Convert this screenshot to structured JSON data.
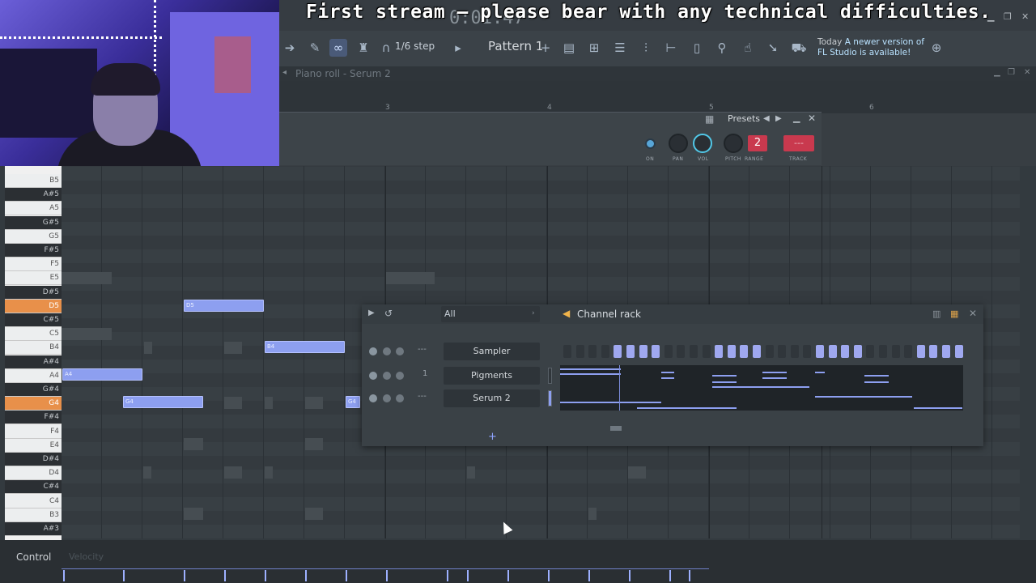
{
  "caption": "First stream – please bear with any technical difficulties.",
  "clock": "0:01:47",
  "toolbar": {
    "snap": "1/6 step",
    "pattern": "Pattern 1",
    "news_prefix": "Today",
    "news_text": "A newer version of FL Studio is available!"
  },
  "piano_roll": {
    "title": "Piano roll - Serum 2",
    "timeline": [
      "3",
      "4",
      "5",
      "6"
    ],
    "keys": [
      {
        "label": "B5",
        "type": "white"
      },
      {
        "label": "A#5",
        "type": "black"
      },
      {
        "label": "A5",
        "type": "white"
      },
      {
        "label": "G#5",
        "type": "black"
      },
      {
        "label": "G5",
        "type": "white"
      },
      {
        "label": "F#5",
        "type": "black"
      },
      {
        "label": "F5",
        "type": "white"
      },
      {
        "label": "E5",
        "type": "white"
      },
      {
        "label": "D#5",
        "type": "black"
      },
      {
        "label": "D5",
        "type": "hl"
      },
      {
        "label": "C#5",
        "type": "black"
      },
      {
        "label": "C5",
        "type": "white"
      },
      {
        "label": "B4",
        "type": "white"
      },
      {
        "label": "A#4",
        "type": "black"
      },
      {
        "label": "A4",
        "type": "white"
      },
      {
        "label": "G#4",
        "type": "black"
      },
      {
        "label": "G4",
        "type": "hl"
      },
      {
        "label": "F#4",
        "type": "black"
      },
      {
        "label": "F4",
        "type": "white"
      },
      {
        "label": "E4",
        "type": "white"
      },
      {
        "label": "D#4",
        "type": "black"
      },
      {
        "label": "D4",
        "type": "white"
      },
      {
        "label": "C#4",
        "type": "black"
      },
      {
        "label": "C4",
        "type": "white"
      },
      {
        "label": "B3",
        "type": "white"
      },
      {
        "label": "A#3",
        "type": "black"
      }
    ],
    "notes": [
      "D5",
      "B4",
      "A4",
      "G4",
      "G4"
    ]
  },
  "channel_settings": {
    "presets_label": "Presets",
    "labels": {
      "on": "ON",
      "pan": "PAN",
      "vol": "VOL",
      "pitch": "PITCH",
      "range": "RANGE",
      "track": "TRACK"
    },
    "range_value": "2",
    "track_value": "---"
  },
  "channel_rack": {
    "title": "Channel rack",
    "filter": "All",
    "channels": [
      {
        "name": "Sampler",
        "track": "---"
      },
      {
        "name": "Pigments",
        "track": "1"
      },
      {
        "name": "Serum 2",
        "track": "---"
      }
    ],
    "steps": [
      0,
      0,
      0,
      0,
      1,
      1,
      1,
      1,
      0,
      0,
      0,
      0,
      1,
      1,
      1,
      1,
      0,
      0,
      0,
      0,
      1,
      1,
      1,
      1,
      0,
      0,
      0,
      0,
      1,
      1,
      1,
      1
    ]
  },
  "control": {
    "label": "Control",
    "velocity_label": "Velocity"
  },
  "colors": {
    "note": "#8d9ff0",
    "highlight_key": "#e8904a",
    "accent_red": "#c9394e",
    "vol_knob": "#51c8e8"
  }
}
